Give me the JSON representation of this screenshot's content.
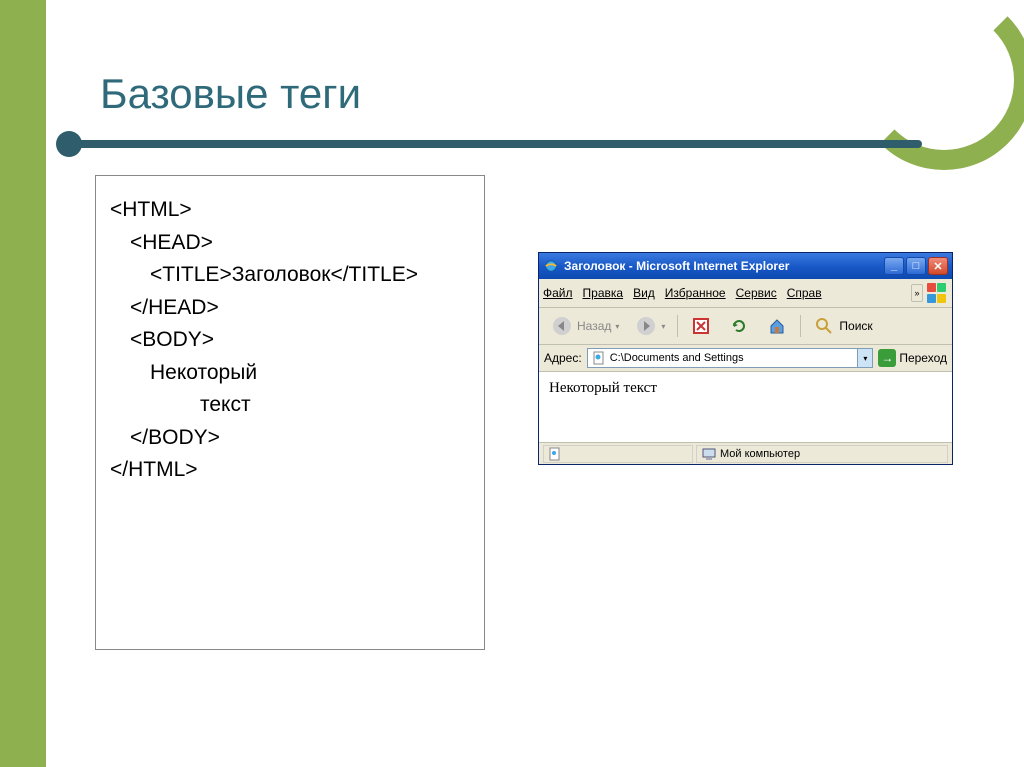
{
  "slide": {
    "title": "Базовые теги"
  },
  "code": {
    "lines": [
      {
        "cls": "l1",
        "text": "<HTML>"
      },
      {
        "cls": "l2",
        "text": "<HEAD>"
      },
      {
        "cls": "l3",
        "text": "<TITLE>Заголовок</TITLE>"
      },
      {
        "cls": "l2",
        "text": "</HEAD>"
      },
      {
        "cls": "l2",
        "text": "<BODY>"
      },
      {
        "cls": "l3",
        "text": "Некоторый"
      },
      {
        "cls": "l5",
        "text": "текст"
      },
      {
        "cls": "l2",
        "text": "</BODY>"
      },
      {
        "cls": "l1",
        "text": "</HTML>"
      }
    ]
  },
  "ie": {
    "title": "Заголовок - Microsoft Internet Explorer",
    "menus": {
      "file": "Файл",
      "edit": "Правка",
      "view": "Вид",
      "favorites": "Избранное",
      "tools": "Сервис",
      "help": "Справ"
    },
    "toolbar": {
      "back": "Назад",
      "search": "Поиск"
    },
    "addressLabel": "Адрес:",
    "addressValue": "C:\\Documents and Settings",
    "goLabel": "Переход",
    "pageBody": "Некоторый текст",
    "status": {
      "done": "",
      "zone": "Мой компьютер"
    }
  }
}
